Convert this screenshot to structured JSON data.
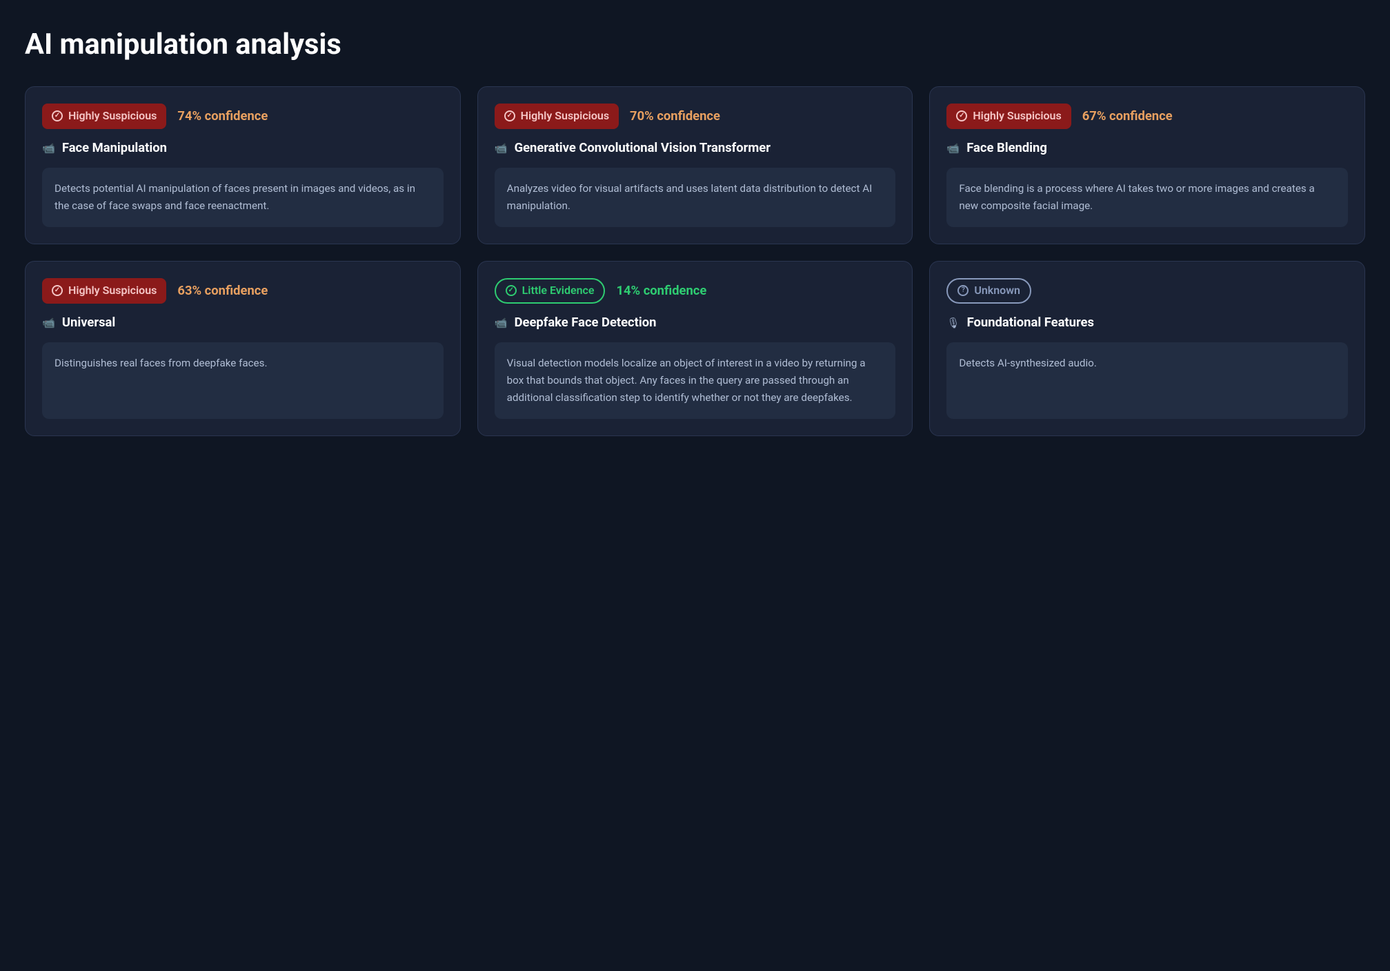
{
  "page": {
    "title": "AI manipulation analysis"
  },
  "cards": [
    {
      "id": "face-manipulation",
      "badge_type": "suspicious",
      "badge_label": "Highly Suspicious",
      "confidence": "74%",
      "confidence_label": "confidence",
      "icon_type": "video",
      "title": "Face Manipulation",
      "description": "Detects potential AI manipulation of faces present in images and videos, as in the case of face swaps and face reenactment."
    },
    {
      "id": "generative-conv",
      "badge_type": "suspicious",
      "badge_label": "Highly Suspicious",
      "confidence": "70%",
      "confidence_label": "confidence",
      "icon_type": "video",
      "title": "Generative Convolutional Vision Transformer",
      "description": "Analyzes video for visual artifacts and uses latent data distribution to detect AI manipulation."
    },
    {
      "id": "face-blending",
      "badge_type": "suspicious",
      "badge_label": "Highly Suspicious",
      "confidence": "67%",
      "confidence_label": "confidence",
      "icon_type": "video",
      "title": "Face Blending",
      "description": "Face blending is a process where AI takes two or more images and creates a new composite facial image."
    },
    {
      "id": "universal",
      "badge_type": "suspicious",
      "badge_label": "Highly Suspicious",
      "confidence": "63%",
      "confidence_label": "confidence",
      "icon_type": "video",
      "title": "Universal",
      "description": "Distinguishes real faces from deepfake faces."
    },
    {
      "id": "deepfake-face",
      "badge_type": "little-evidence",
      "badge_label": "Little Evidence",
      "confidence": "14%",
      "confidence_label": "confidence",
      "icon_type": "video",
      "title": "Deepfake Face Detection",
      "description": "Visual detection models localize an object of interest in a video by returning a box that bounds that object. Any faces in the query are passed through an additional classification step to identify whether or not they are deepfakes."
    },
    {
      "id": "foundational",
      "badge_type": "unknown",
      "badge_label": "Unknown",
      "confidence": "",
      "confidence_label": "",
      "icon_type": "mic",
      "title": "Foundational Features",
      "description": "Detects AI-synthesized audio."
    }
  ]
}
